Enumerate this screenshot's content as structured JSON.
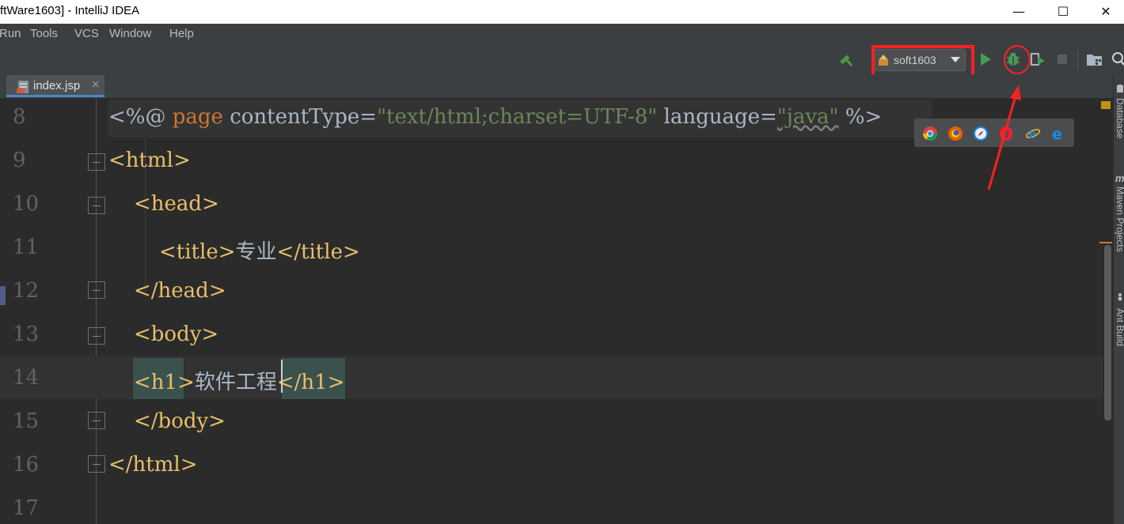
{
  "window": {
    "title": "ftWare1603] - IntelliJ IDEA",
    "minimize_glyph": "—",
    "maximize_glyph": "☐",
    "close_glyph": "✕"
  },
  "menu": {
    "items": [
      {
        "label": "Run"
      },
      {
        "label": "Tools"
      },
      {
        "label": "VCS"
      },
      {
        "label": "Window"
      },
      {
        "label": "Help"
      }
    ]
  },
  "toolbar": {
    "run_config_label": "soft1603",
    "icons": [
      "build-hammer-icon",
      "run-config-icon",
      "dropdown-arrow-icon",
      "run-icon",
      "debug-icon",
      "coverage-icon",
      "stop-icon",
      "project-structure-icon",
      "search-icon"
    ]
  },
  "tab": {
    "label": "index.jsp",
    "close_glyph": "×"
  },
  "right_panels": [
    {
      "label": "Database"
    },
    {
      "label": "Maven Projects"
    },
    {
      "label": "Ant Build"
    }
  ],
  "editor": {
    "line_numbers": [
      "8",
      "9",
      "10",
      "11",
      "12",
      "13",
      "14",
      "15",
      "16",
      "17"
    ],
    "line8": {
      "open": "<%@ ",
      "kw": "page",
      "attr1": " contentType=",
      "val1": "\"text/html;charset=UTF-8\"",
      "attr2": " language=",
      "val2": "\"java\"",
      "close": " %>"
    },
    "line9": "<html>",
    "line10": "<head>",
    "line11": {
      "open": "<title>",
      "text": "专业",
      "close": "</title>"
    },
    "line12": "</head>",
    "line13": "<body>",
    "line14": {
      "open": "<h1>",
      "text": "软件工程",
      "close": "</h1>"
    },
    "line15": "</body>",
    "line16": "</html>"
  },
  "browser_popup": {
    "icons": [
      "chrome-icon",
      "firefox-icon",
      "safari-icon",
      "opera-icon",
      "ie-icon",
      "edge-icon"
    ]
  },
  "colors": {
    "annotation_red": "#ff2020",
    "tag": "#e8bf6a",
    "string": "#6a8759",
    "keyword": "#cc7832",
    "background": "#2b2b2b"
  }
}
